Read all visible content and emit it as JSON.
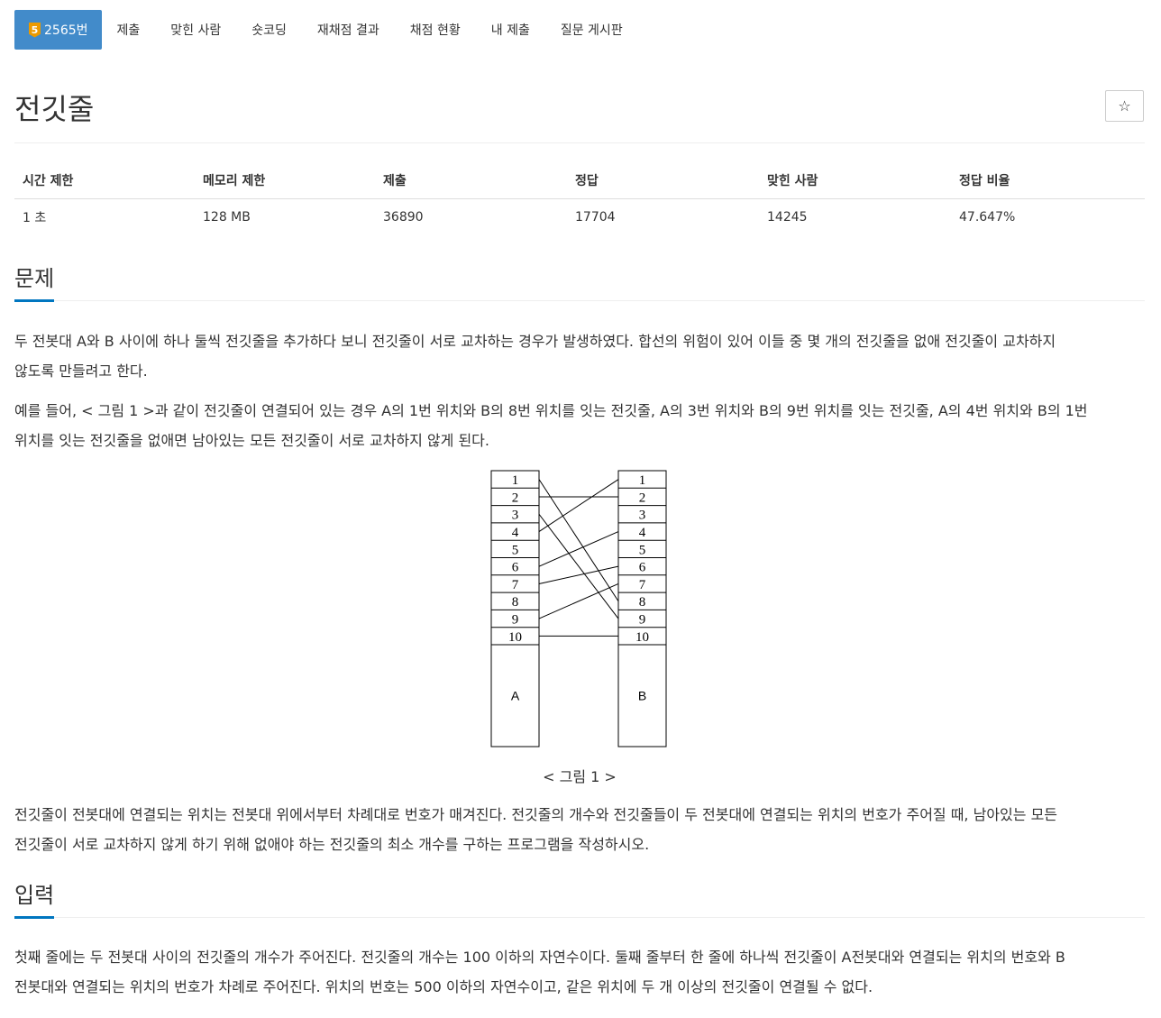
{
  "nav": {
    "tier": "5",
    "problem_tab": "2565번",
    "tabs": [
      "제출",
      "맞힌 사람",
      "숏코딩",
      "재채점 결과",
      "채점 현황",
      "내 제출",
      "질문 게시판"
    ]
  },
  "problem": {
    "title": "전깃줄",
    "star_icon": "☆"
  },
  "info_table": {
    "headers": [
      "시간 제한",
      "메모리 제한",
      "제출",
      "정답",
      "맞힌 사람",
      "정답 비율"
    ],
    "values": [
      "1 초",
      "128 MB",
      "36890",
      "17704",
      "14245",
      "47.647%"
    ]
  },
  "description": {
    "heading": "문제",
    "p1_line1": "두 전봇대 A와 B 사이에 하나 둘씩 전깃줄을 추가하다 보니 전깃줄이 서로 교차하는 경우가 발생하였다. 합선의 위험이 있어 이들 중 몇 개의 전깃줄을 없애 전깃줄이 교차하지",
    "p1_line2": "않도록 만들려고 한다.",
    "p2_line1": "예를 들어, < 그림 1 >과 같이 전깃줄이 연결되어 있는 경우 A의 1번 위치와 B의 8번 위치를 잇는 전깃줄, A의 3번 위치와 B의 9번 위치를 잇는 전깃줄, A의 4번 위치와 B의 1번",
    "p2_line2": "위치를 잇는 전깃줄을 없애면 남아있는 모든 전깃줄이 서로 교차하지 않게 된다.",
    "figure": {
      "slots": [
        "1",
        "2",
        "3",
        "4",
        "5",
        "6",
        "7",
        "8",
        "9",
        "10"
      ],
      "pole_a": "A",
      "pole_b": "B",
      "connections": [
        [
          1,
          8
        ],
        [
          2,
          2
        ],
        [
          3,
          9
        ],
        [
          4,
          1
        ],
        [
          6,
          4
        ],
        [
          7,
          6
        ],
        [
          9,
          7
        ],
        [
          10,
          10
        ]
      ],
      "caption": "< 그림 1 >"
    },
    "p3_line1": "전깃줄이 전봇대에 연결되는 위치는 전봇대 위에서부터 차례대로 번호가 매겨진다. 전깃줄의 개수와 전깃줄들이 두 전봇대에 연결되는 위치의 번호가 주어질 때, 남아있는 모든",
    "p3_line2": "전깃줄이 서로 교차하지 않게 하기 위해 없애야 하는 전깃줄의 최소 개수를 구하는 프로그램을 작성하시오."
  },
  "input_section": {
    "heading": "입력",
    "line1": "첫째 줄에는 두 전봇대 사이의 전깃줄의 개수가 주어진다. 전깃줄의 개수는 100 이하의 자연수이다. 둘째 줄부터 한 줄에 하나씩 전깃줄이 A전봇대와 연결되는 위치의 번호와 B",
    "line2": "전봇대와 연결되는 위치의 번호가 차례로 주어진다. 위치의 번호는 500 이하의 자연수이고, 같은 위치에 두 개 이상의 전깃줄이 연결될 수 없다."
  }
}
